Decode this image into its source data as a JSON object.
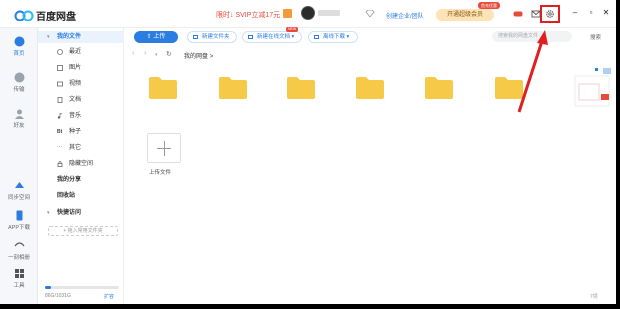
{
  "app": {
    "title": "百度网盘"
  },
  "header": {
    "promo": "限时↓ SVIP立减17元",
    "create_enterprise": "创建企业/团队",
    "vip_button": "开通超级会员",
    "vip_badge": "首充优惠"
  },
  "rail": [
    {
      "label": "首页",
      "icon": "home-icon",
      "active": true
    },
    {
      "label": "传输",
      "icon": "transfer-icon"
    },
    {
      "label": "好友",
      "icon": "friends-icon"
    },
    {
      "label": "同步空间",
      "icon": "sync-icon"
    },
    {
      "label": "APP下载",
      "icon": "phone-icon"
    },
    {
      "label": "一刻相册",
      "icon": "album-icon"
    },
    {
      "label": "工具",
      "icon": "tools-icon"
    }
  ],
  "sidebar": {
    "my_files": "我的文件",
    "items": [
      {
        "label": "最近",
        "icon": "clock-icon"
      },
      {
        "label": "图片",
        "icon": "image-icon"
      },
      {
        "label": "视频",
        "icon": "video-icon"
      },
      {
        "label": "文档",
        "icon": "document-icon"
      },
      {
        "label": "音乐",
        "icon": "music-icon"
      },
      {
        "label": "种子",
        "icon": "bt-icon",
        "icon_text": "Bt"
      },
      {
        "label": "其它",
        "icon": "more-icon",
        "icon_text": "···"
      },
      {
        "label": "隐藏空间",
        "icon": "lock-icon"
      }
    ],
    "my_share": "我的分享",
    "recycle": "回收站",
    "quick_access": "快捷访问",
    "add_quick": "+ 拖入常用文件夹",
    "storage_text": "86G/1031G",
    "storage_fraction": 0.083,
    "expand": "扩容"
  },
  "toolbar": {
    "upload": "上传",
    "new_folder": "新建文件夹",
    "new_online_doc": "新建在线文档",
    "new_badge": "NEW",
    "offline_download": "离线下载",
    "search_placeholder": "搜索我的网盘文件",
    "search_button": "搜索"
  },
  "path": {
    "current": "我的网盘",
    "sep": ">"
  },
  "files": {
    "folders": 6,
    "upload_tile_label": "上传文件"
  },
  "status": {
    "count": "7项"
  },
  "colors": {
    "accent": "#2a7de1",
    "folder": "#f7c948",
    "highlight": "#e02020"
  }
}
